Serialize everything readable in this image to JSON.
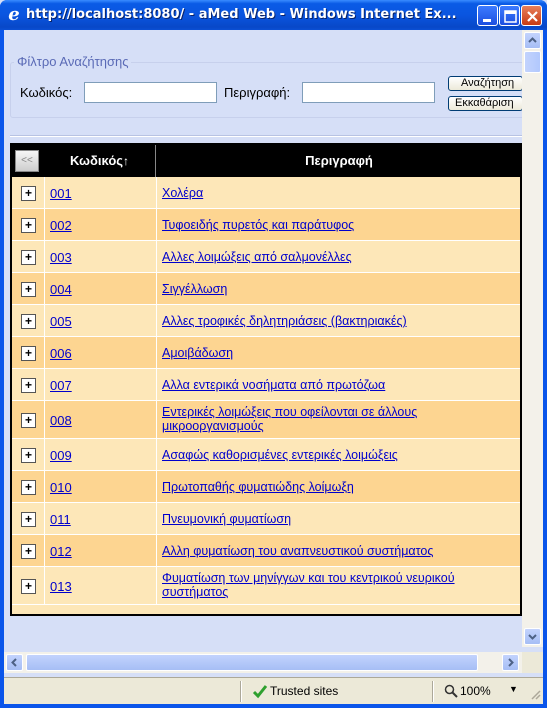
{
  "window": {
    "title": "http://localhost:8080/ - aMed Web - Windows Internet Ex...",
    "colors": {
      "titlebar": "#0a55ea",
      "row_odd": "#fde7b8",
      "row_even": "#fdd591",
      "link": "#0000cc"
    }
  },
  "filter": {
    "legend": "Φίλτρο Αναζήτησης",
    "code_label": "Κωδικός:",
    "code_value": "",
    "desc_label": "Περιγραφή:",
    "desc_value": "",
    "search_button": "Αναζήτηση",
    "clear_button": "Εκκαθάριση"
  },
  "grid": {
    "collapse_label": "<<",
    "header_code": "Κωδικός",
    "sort_indicator": "↑",
    "header_desc": "Περιγραφή",
    "expand_label": "+",
    "rows": [
      {
        "code": "001",
        "desc": "Χολέρα"
      },
      {
        "code": "002",
        "desc": "Τυφοειδής πυρετός και παράτυφος"
      },
      {
        "code": "003",
        "desc": "Αλλες λοιμώξεις από σαλμονέλλες"
      },
      {
        "code": "004",
        "desc": "Σιγγέλλωση"
      },
      {
        "code": "005",
        "desc": "Αλλες τροφικές δηλητηριάσεις (βακτηριακές)"
      },
      {
        "code": "006",
        "desc": "Αμοιβάδωση"
      },
      {
        "code": "007",
        "desc": "Αλλα εντερικά νοσήματα από πρωτόζωα"
      },
      {
        "code": "008",
        "desc": "Εντερικές λοιμώξεις που οφείλονται σε άλλους μικροοργανισμούς"
      },
      {
        "code": "009",
        "desc": "Ασαφώς καθορισμένες εντερικές λοιμώξεις"
      },
      {
        "code": "010",
        "desc": "Πρωτοπαθής φυματιώδης λοίμωξη"
      },
      {
        "code": "011",
        "desc": "Πνευμονική φυματίωση"
      },
      {
        "code": "012",
        "desc": "Αλλη φυματίωση του αναπνευστικού συστήματος"
      },
      {
        "code": "013",
        "desc": "Φυματίωση των μηνίγγων και του κεντρικού νευρικού συστήματος"
      }
    ]
  },
  "status": {
    "zone": "Trusted sites",
    "zoom": "100%",
    "zoom_dropdown": "▼"
  }
}
